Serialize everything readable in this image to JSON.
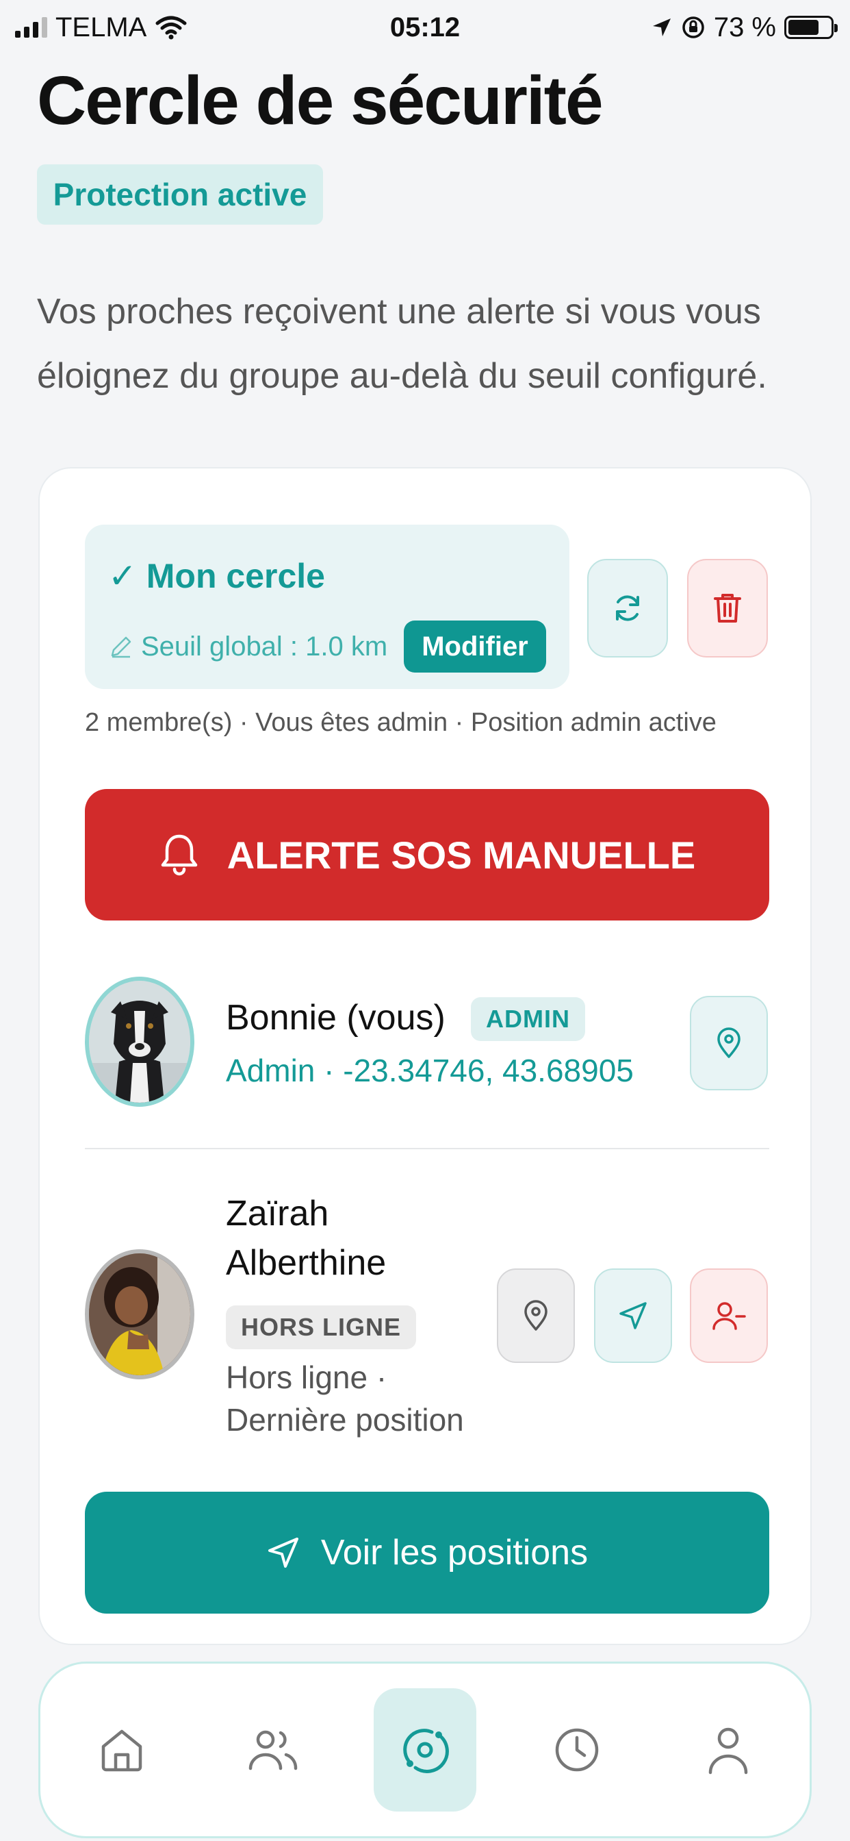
{
  "status_bar": {
    "carrier": "TELMA",
    "time": "05:12",
    "battery": "73 %",
    "battery_level": 0.73
  },
  "page": {
    "title": "Cercle de sécurité",
    "status_chip": "Protection active",
    "intro": "Vos proches reçoivent une alerte si vous vous éloignez du groupe au-delà du seuil configuré."
  },
  "circle": {
    "name": "✓ Mon cercle",
    "threshold": "Seuil global : 1.0 km",
    "modify_label": "Modifier",
    "meta": "2 membre(s) · Vous êtes admin · Position admin active",
    "icons": {
      "refresh": "refresh-icon",
      "delete": "trash-icon"
    }
  },
  "sos": {
    "label": "ALERTE SOS MANUELLE",
    "icon": "bell-icon",
    "color": "#d22b2b"
  },
  "members": [
    {
      "name": "Bonnie  (vous)",
      "badge": "ADMIN",
      "subtitle": "Admin · -23.34746, 43.68905",
      "actions": [
        "map-pin-icon"
      ]
    },
    {
      "name_line1": "Zaïrah",
      "name_line2": "Alberthine",
      "badge": "HORS LIGNE",
      "subtitle_line1": "Hors ligne ·",
      "subtitle_line2": "Dernière position",
      "actions": [
        "map-pin-icon",
        "navigation-icon",
        "remove-user-icon"
      ]
    }
  ],
  "positions_button": {
    "label": "Voir les positions",
    "icon": "navigation-icon"
  },
  "bottom_nav": [
    {
      "name": "home",
      "icon": "home-icon",
      "active": false
    },
    {
      "name": "contacts",
      "icon": "users-icon",
      "active": false
    },
    {
      "name": "circle",
      "icon": "circle-orbit-icon",
      "active": true
    },
    {
      "name": "history",
      "icon": "clock-icon",
      "active": false
    },
    {
      "name": "profile",
      "icon": "user-icon",
      "active": false
    }
  ],
  "colors": {
    "accent": "#0f9792",
    "danger": "#d22b2b",
    "background": "#f4f5f7"
  }
}
